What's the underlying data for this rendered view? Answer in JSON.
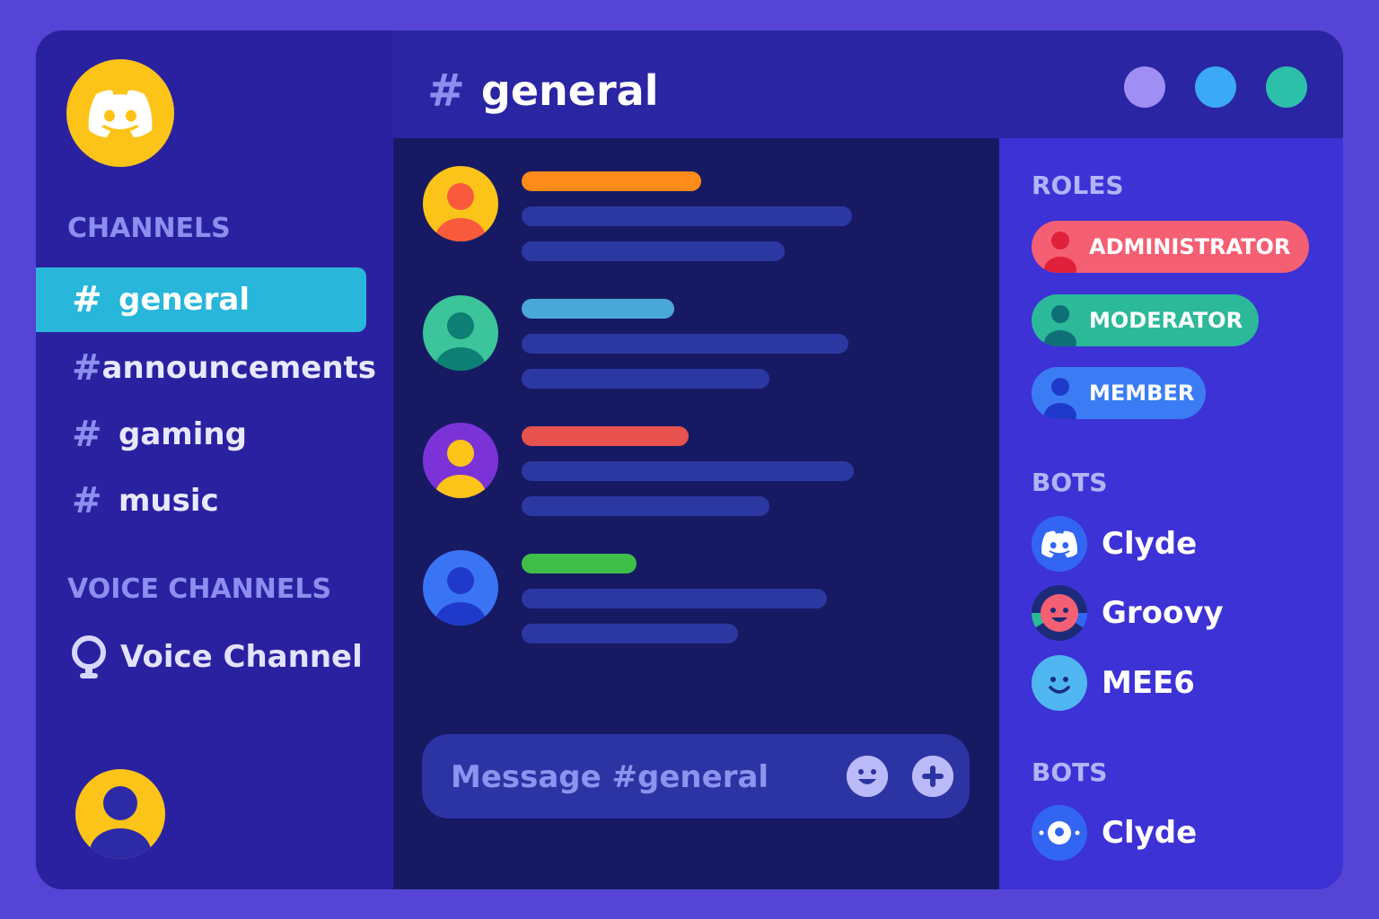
{
  "header": {
    "title": "general",
    "hash": "#"
  },
  "sidebar": {
    "channels_label": "CHANNELS",
    "channels": [
      {
        "label": "general",
        "active": true
      },
      {
        "label": "announcements",
        "active": false
      },
      {
        "label": "gaming",
        "active": false
      },
      {
        "label": "music",
        "active": false
      }
    ],
    "voice_label": "VOICE CHANNELS",
    "voice_channel": "Voice Channel"
  },
  "window_controls": [
    "#9f8ff5",
    "#3ba9f5",
    "#2cbfa9"
  ],
  "messages": [
    {
      "avatar_bg": "#fcc419",
      "avatar_fg": "#fa5a3c",
      "name_color": "#ff8c1a"
    },
    {
      "avatar_bg": "#3cc49a",
      "avatar_fg": "#0d7f74",
      "name_color": "#4aa8d8"
    },
    {
      "avatar_bg": "#7b33d8",
      "avatar_fg": "#fcc419",
      "name_color": "#e8524f"
    },
    {
      "avatar_bg": "#3a73f3",
      "avatar_fg": "#1f3acb",
      "name_color": "#3fbf4a"
    }
  ],
  "composer": {
    "placeholder": "Message #general"
  },
  "members": {
    "roles_label": "ROLES",
    "roles": [
      {
        "label": "ADMINISTRATOR",
        "color": "#f45f73",
        "icon_color": "#e0213b"
      },
      {
        "label": "MODERATOR",
        "color": "#2bb99a",
        "icon_color": "#0f6f77"
      },
      {
        "label": "MEMBER",
        "color": "#3b7cf4",
        "icon_color": "#1f3acb"
      }
    ],
    "bots_label": "BOTS",
    "bots": [
      "Clyde",
      "Groovy",
      "MEE6"
    ],
    "bots2_label": "BOTS",
    "bots2": [
      "Clyde"
    ]
  }
}
